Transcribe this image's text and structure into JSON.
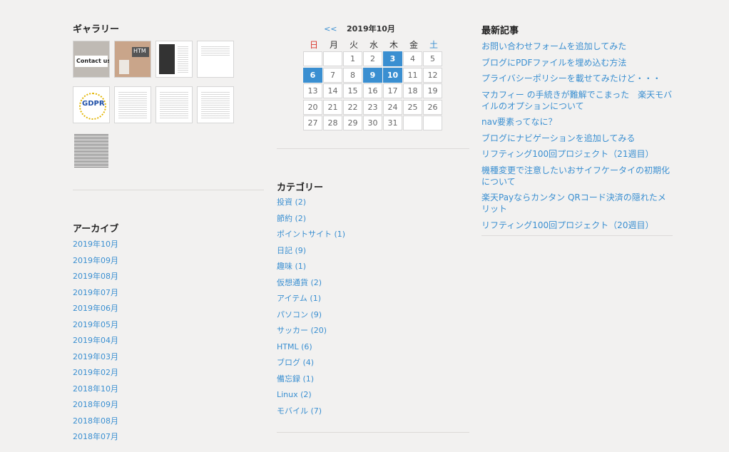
{
  "gallery": {
    "title": "ギャラリー",
    "thumbs": [
      {
        "label": "Contact us"
      },
      {
        "label": "HTM"
      },
      {
        "label": ""
      },
      {
        "label": ""
      },
      {
        "label": "GDPR"
      },
      {
        "label": ""
      },
      {
        "label": ""
      },
      {
        "label": ""
      },
      {
        "label": ""
      }
    ]
  },
  "archive": {
    "title": "アーカイブ",
    "items": [
      "2019年10月",
      "2019年09月",
      "2019年08月",
      "2019年07月",
      "2019年06月",
      "2019年05月",
      "2019年04月",
      "2019年03月",
      "2019年02月",
      "2018年10月",
      "2018年09月",
      "2018年08月",
      "2018年07月"
    ]
  },
  "calendar": {
    "prev": "<<",
    "caption": "2019年10月",
    "weekdays": [
      "日",
      "月",
      "火",
      "水",
      "木",
      "金",
      "土"
    ],
    "colors": {
      "sunday": "#d9362b",
      "saturday": "#3a8fd1",
      "weekday": "#333333",
      "link_bg": "#3a8fd1"
    },
    "rows": [
      [
        "",
        "",
        "1",
        "2",
        "3",
        "4",
        "5"
      ],
      [
        "6",
        "7",
        "8",
        "9",
        "10",
        "11",
        "12"
      ],
      [
        "13",
        "14",
        "15",
        "16",
        "17",
        "18",
        "19"
      ],
      [
        "20",
        "21",
        "22",
        "23",
        "24",
        "25",
        "26"
      ],
      [
        "27",
        "28",
        "29",
        "30",
        "31",
        "",
        ""
      ]
    ],
    "linked_days": [
      "3",
      "6",
      "9",
      "10"
    ]
  },
  "categories": {
    "title": "カテゴリー",
    "items": [
      {
        "name": "投資",
        "count": "(2)"
      },
      {
        "name": "節約",
        "count": "(2)"
      },
      {
        "name": "ポイントサイト",
        "count": "(1)"
      },
      {
        "name": "日記",
        "count": "(9)"
      },
      {
        "name": "趣味",
        "count": "(1)"
      },
      {
        "name": "仮想通貨",
        "count": "(2)"
      },
      {
        "name": "アイテム",
        "count": "(1)"
      },
      {
        "name": "パソコン",
        "count": "(9)"
      },
      {
        "name": "サッカー",
        "count": "(20)"
      },
      {
        "name": "HTML",
        "count": "(6)"
      },
      {
        "name": "ブログ",
        "count": "(4)"
      },
      {
        "name": "備忘録",
        "count": "(1)"
      },
      {
        "name": "Linux",
        "count": "(2)"
      },
      {
        "name": "モバイル",
        "count": "(7)"
      }
    ]
  },
  "recent": {
    "title": "最新記事",
    "items": [
      "お問い合わせフォームを追加してみた",
      "ブログにPDFファイルを埋め込む方法",
      "プライバシーポリシーを載せてみたけど・・・",
      "マカフィー の手続きが難解でこまった　楽天モバイルのオプションについて",
      "nav要素ってなに？",
      "ブログにナビゲーションを追加してみる",
      "リフティング100回プロジェクト（21週目）",
      "機種変更で注意したいおサイフケータイの初期化について",
      "楽天Payならカンタン QRコード決済の隠れたメリット",
      "リフティング100回プロジェクト（20週目）"
    ]
  }
}
